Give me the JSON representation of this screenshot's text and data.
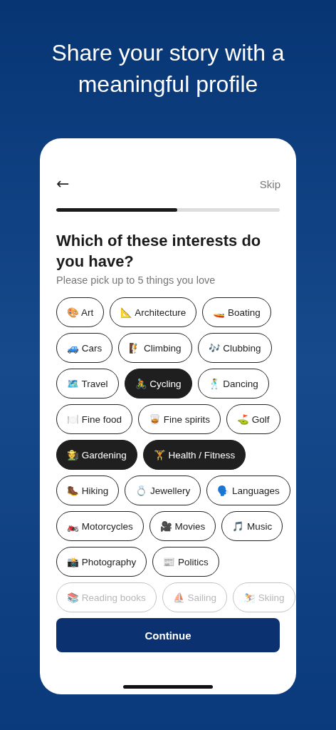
{
  "headline": "Share your story with a meaningful profile",
  "header": {
    "back": "←",
    "skip": "Skip"
  },
  "progress": {
    "level": 0.54
  },
  "question": "Which of these interests do you have?",
  "subtitle": "Please pick up to 5 things you love",
  "interest_rows": [
    [
      {
        "label": "🎨 Art",
        "selected": false,
        "faded": false
      },
      {
        "label": "📐 Architecture",
        "selected": false,
        "faded": false
      },
      {
        "label": "🚤 Boating",
        "selected": false,
        "faded": false
      }
    ],
    [
      {
        "label": "🚙 Cars",
        "selected": false,
        "faded": false
      },
      {
        "label": "🧗 Climbing",
        "selected": false,
        "faded": false
      },
      {
        "label": "🎶 Clubbing",
        "selected": false,
        "faded": false
      }
    ],
    [
      {
        "label": "🗺️ Travel",
        "selected": false,
        "faded": false
      },
      {
        "label": "🚴 Cycling",
        "selected": true,
        "faded": false
      },
      {
        "label": "🕺 Dancing",
        "selected": false,
        "faded": false
      }
    ],
    [
      {
        "label": "🍽️ Fine food",
        "selected": false,
        "faded": false
      },
      {
        "label": "🥃 Fine spirits",
        "selected": false,
        "faded": false
      },
      {
        "label": "⛳ Golf",
        "selected": false,
        "faded": false
      }
    ],
    [
      {
        "label": "🧑‍🌾 Gardening",
        "selected": true,
        "faded": false
      },
      {
        "label": "🏋️ Health / Fitness",
        "selected": true,
        "faded": false
      }
    ],
    [
      {
        "label": "🥾 Hiking",
        "selected": false,
        "faded": false
      },
      {
        "label": "💍 Jewellery",
        "selected": false,
        "faded": false
      },
      {
        "label": "🗣️ Languages",
        "selected": false,
        "faded": false
      }
    ],
    [
      {
        "label": "🏍️ Motorcycles",
        "selected": false,
        "faded": false
      },
      {
        "label": "🎥 Movies",
        "selected": false,
        "faded": false
      },
      {
        "label": "🎵 Music",
        "selected": false,
        "faded": false
      }
    ],
    [
      {
        "label": "📸 Photography",
        "selected": false,
        "faded": false
      },
      {
        "label": "📰 Politics",
        "selected": false,
        "faded": false
      }
    ],
    [
      {
        "label": "📚 Reading books",
        "selected": false,
        "faded": true
      },
      {
        "label": "⛵ Sailing",
        "selected": false,
        "faded": true
      },
      {
        "label": "⛷️ Skiing",
        "selected": false,
        "faded": true
      }
    ]
  ],
  "continue_button": "Continue"
}
